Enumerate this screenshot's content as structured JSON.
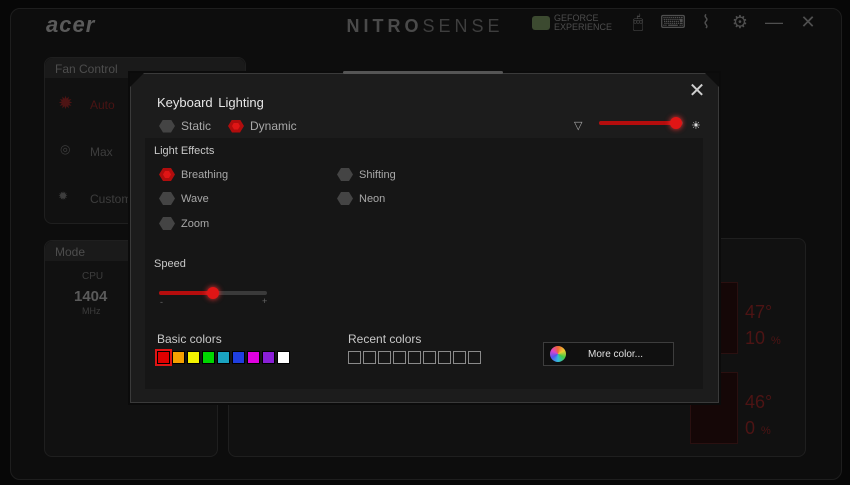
{
  "app": {
    "brand": "acer",
    "title_bold": "NITRO",
    "title_light": "SENSE",
    "geforce_line1": "GEFORCE",
    "geforce_line2": "EXPERIENCE",
    "icons": [
      "nvidia-eye-icon",
      "mouse-icon",
      "keyboard-icon",
      "audio-wave-icon",
      "gear-icon",
      "minimize-icon",
      "close-icon"
    ]
  },
  "background": {
    "fan_control_label": "Fan Control",
    "fan_auto": "Auto",
    "fan_max": "Max",
    "fan_custom": "Custom",
    "mode_label": "Mode",
    "cpu_label": "CPU",
    "cpu_value": "1404",
    "cpu_unit": "MHz",
    "temp1": "47°",
    "usage1": "10",
    "temp2": "46°",
    "usage2": "0",
    "percent": "%"
  },
  "dialog": {
    "title": "Keyboard  Lighting",
    "modes": [
      {
        "label": "Static",
        "selected": false
      },
      {
        "label": "Dynamic",
        "selected": true
      }
    ],
    "brightness_level": 0.92,
    "light_effects_label": "Light Effects",
    "effects": [
      {
        "label": "Breathing",
        "selected": true
      },
      {
        "label": "Wave",
        "selected": false
      },
      {
        "label": "Zoom",
        "selected": false
      },
      {
        "label": "Shifting",
        "selected": false
      },
      {
        "label": "Neon",
        "selected": false
      }
    ],
    "speed_label": "Speed",
    "speed_level": 0.5,
    "speed_min": "-",
    "speed_max": "+",
    "basic_colors_label": "Basic colors",
    "basic_colors": [
      "#e00000",
      "#f5a000",
      "#f3f300",
      "#00d800",
      "#1aa3c0",
      "#1f3fe0",
      "#e000e0",
      "#8b1fd8",
      "#ffffff"
    ],
    "selected_color_index": 0,
    "recent_colors_label": "Recent colors",
    "recent_count": 9,
    "more_color_label": "More color..."
  },
  "colors": {
    "accent": "#e01515",
    "panel": "#1c1c1c"
  }
}
